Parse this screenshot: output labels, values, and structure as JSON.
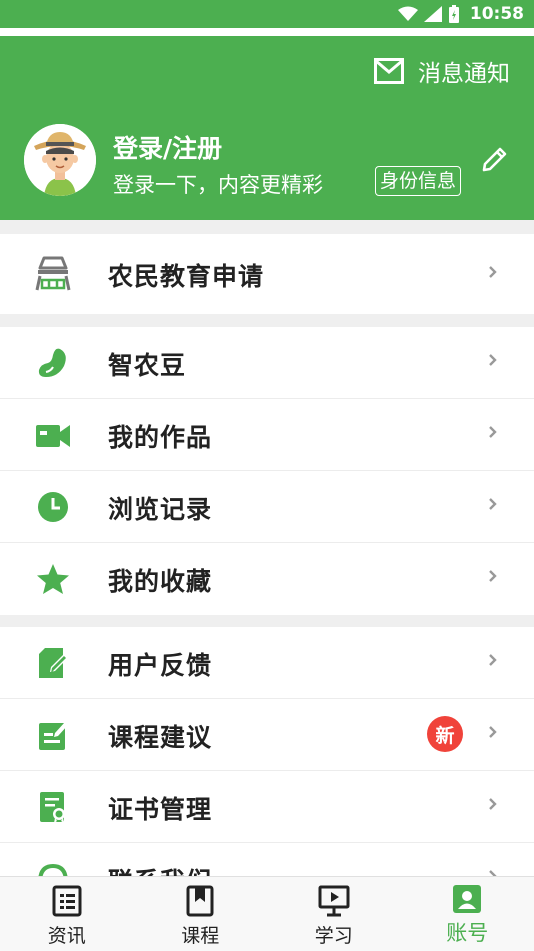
{
  "status": {
    "time": "10:58"
  },
  "header": {
    "notify_label": "消息通知",
    "login_title": "登录/注册",
    "login_subtitle": "登录一下，内容更精彩",
    "identity_button": "身份信息"
  },
  "menu": {
    "apply": {
      "label": "农民教育申请",
      "icon": "farmer-stall-icon"
    },
    "items": [
      {
        "label": "智农豆",
        "icon": "bean-icon"
      },
      {
        "label": "我的作品",
        "icon": "video-camera-icon"
      },
      {
        "label": "浏览记录",
        "icon": "clock-icon"
      },
      {
        "label": "我的收藏",
        "icon": "star-icon"
      }
    ],
    "more": [
      {
        "label": "用户反馈",
        "icon": "feedback-edit-icon"
      },
      {
        "label": "课程建议",
        "icon": "suggestion-icon",
        "badge": "新"
      },
      {
        "label": "证书管理",
        "icon": "certificate-icon"
      },
      {
        "label": "联系我们",
        "icon": "headset-icon"
      }
    ]
  },
  "tabs": [
    {
      "label": "资讯",
      "icon": "news-icon",
      "active": false
    },
    {
      "label": "课程",
      "icon": "bookmark-icon",
      "active": false
    },
    {
      "label": "学习",
      "icon": "presentation-icon",
      "active": false
    },
    {
      "label": "账号",
      "icon": "account-icon",
      "active": true
    }
  ],
  "colors": {
    "primary": "#4caf50",
    "badge": "#f0433a"
  }
}
